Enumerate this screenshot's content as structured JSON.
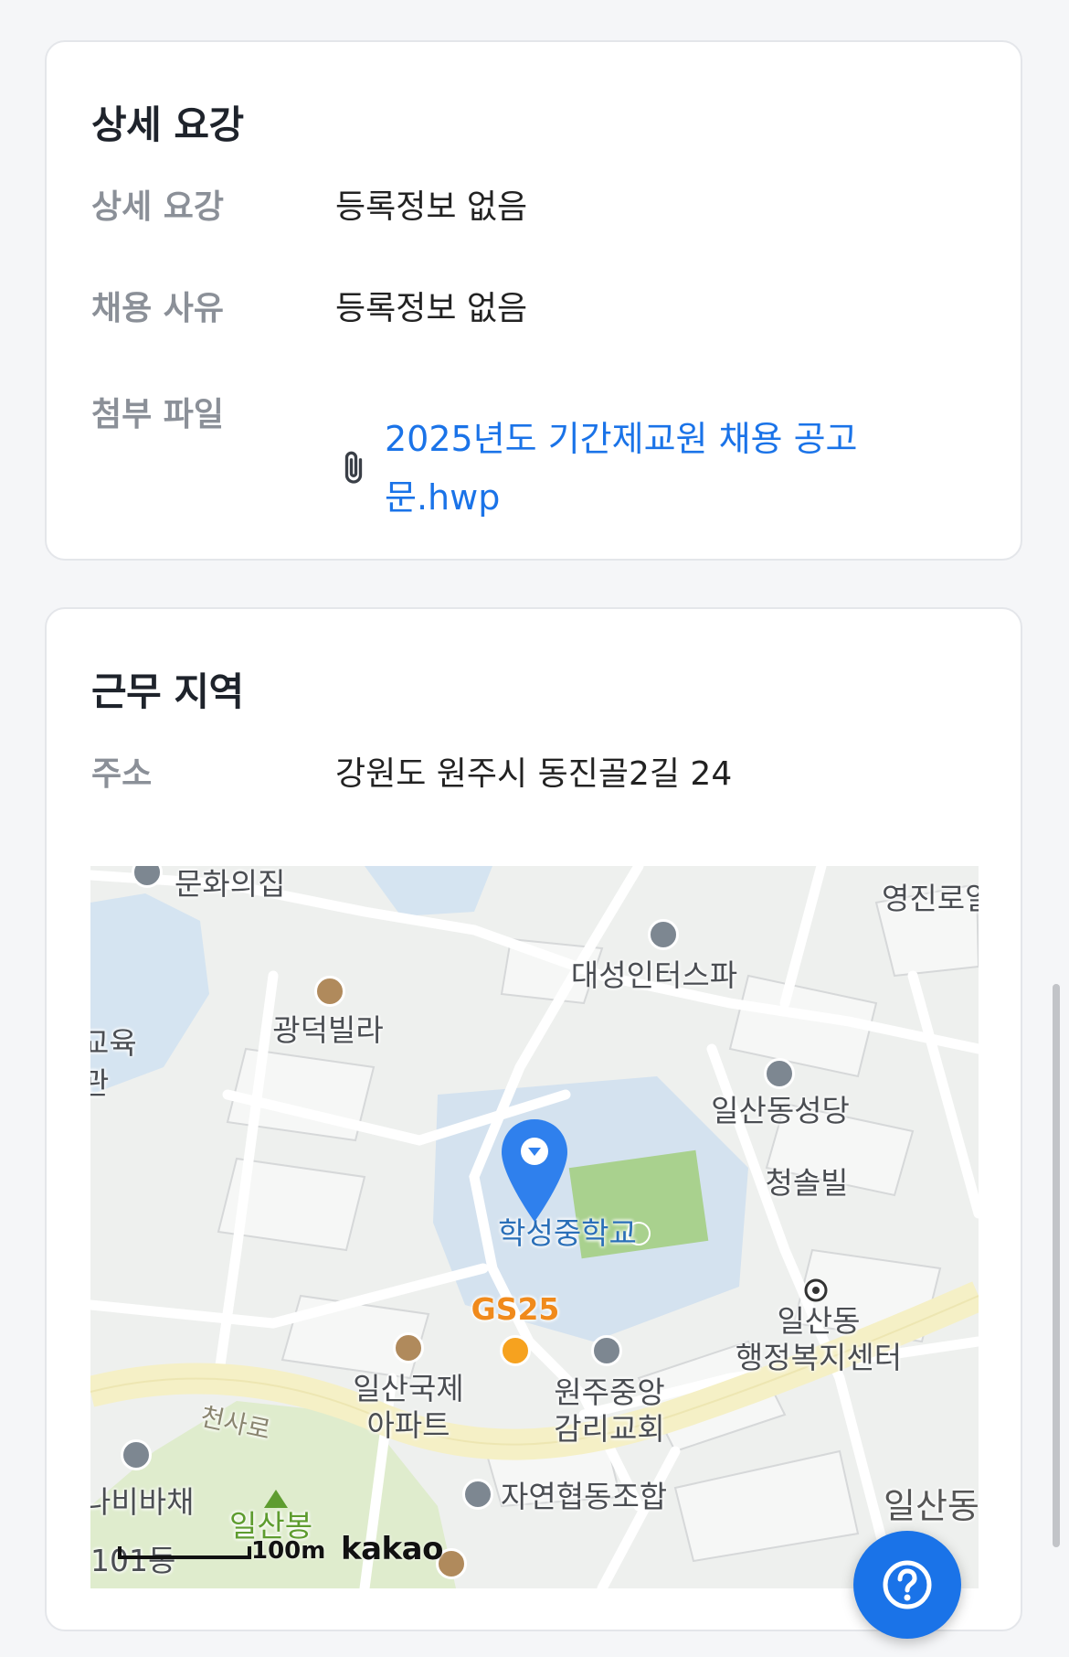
{
  "detail": {
    "title": "상세 요강",
    "rows": [
      {
        "label": "상세 요강",
        "value": "등록정보 없음"
      },
      {
        "label": "채용 사유",
        "value": "등록정보 없음"
      }
    ],
    "attachment": {
      "label": "첨부 파일",
      "file_name": "2025년도 기간제교원 채용 공고문.hwp",
      "icon": "paperclip-icon"
    }
  },
  "location": {
    "title": "근무 지역",
    "address_label": "주소",
    "address": "강원도 원주시 동진골2길 24",
    "map": {
      "labels": {
        "munhwa": "문화의집",
        "daesung": "대성인터스파",
        "yeongjin": "영진로얄",
        "gwangdeok": "광덕빌라",
        "gyoyuk": "교육\n관",
        "ilsan_church": "일산동성당",
        "hakseong": "학성중학교",
        "cheongsol": "청솔빌",
        "gs25": "GS25",
        "ilsan_center": "일산동\n행정복지센터",
        "cheonsaro": "천사로",
        "ilsan_apt": "일산국제\n아파트",
        "wonju_church": "원주중앙\n감리교회",
        "nabi": "나비바채",
        "ilsanbong": "일산봉",
        "coop": "자연협동조합",
        "ilsandong": "일산동",
        "dong101": "101동"
      },
      "scale": "100m",
      "provider": "kakao"
    }
  },
  "help": {
    "icon": "question-icon"
  },
  "colors": {
    "link": "#1a73e8",
    "label": "#8b9098",
    "marker": "#2f80ed"
  }
}
